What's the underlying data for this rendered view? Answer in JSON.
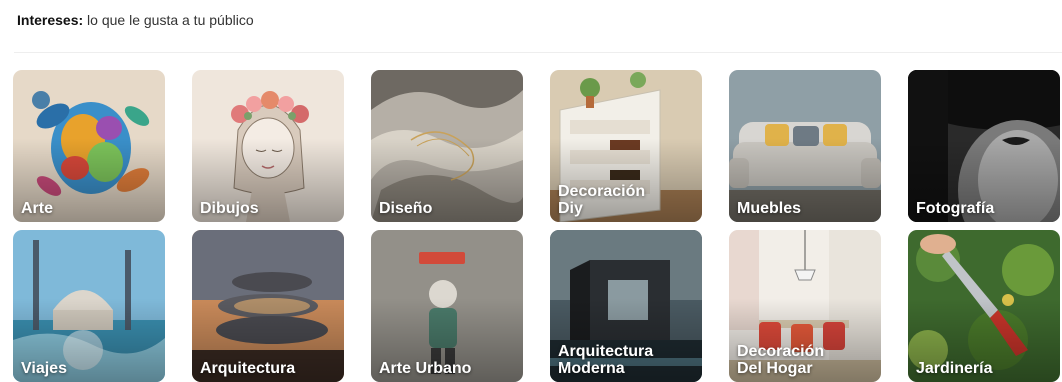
{
  "header": {
    "label_bold": "Intereses:",
    "label_rest": " lo que le gusta a tu público"
  },
  "tiles": [
    {
      "label": "Arte",
      "icon": "sea-turtle-painting"
    },
    {
      "label": "Dibujos",
      "icon": "flower-crown-girl-sketch"
    },
    {
      "label": "Diseño",
      "icon": "abstract-landscape"
    },
    {
      "label": "Decoración\nDiy",
      "icon": "pallet-shelf"
    },
    {
      "label": "Muebles",
      "icon": "sofa"
    },
    {
      "label": "Fotografía",
      "icon": "woman-hat-portrait"
    },
    {
      "label": "Viajes",
      "icon": "mosque-waterfront"
    },
    {
      "label": "Arquitectura",
      "icon": "spiral-building"
    },
    {
      "label": "Arte Urbano",
      "icon": "street-art-child"
    },
    {
      "label": "Arquitectura\nModerna",
      "icon": "modern-house"
    },
    {
      "label": "Decoración\nDel Hogar",
      "icon": "dining-room"
    },
    {
      "label": "Jardinería",
      "icon": "pruning-shears"
    }
  ]
}
